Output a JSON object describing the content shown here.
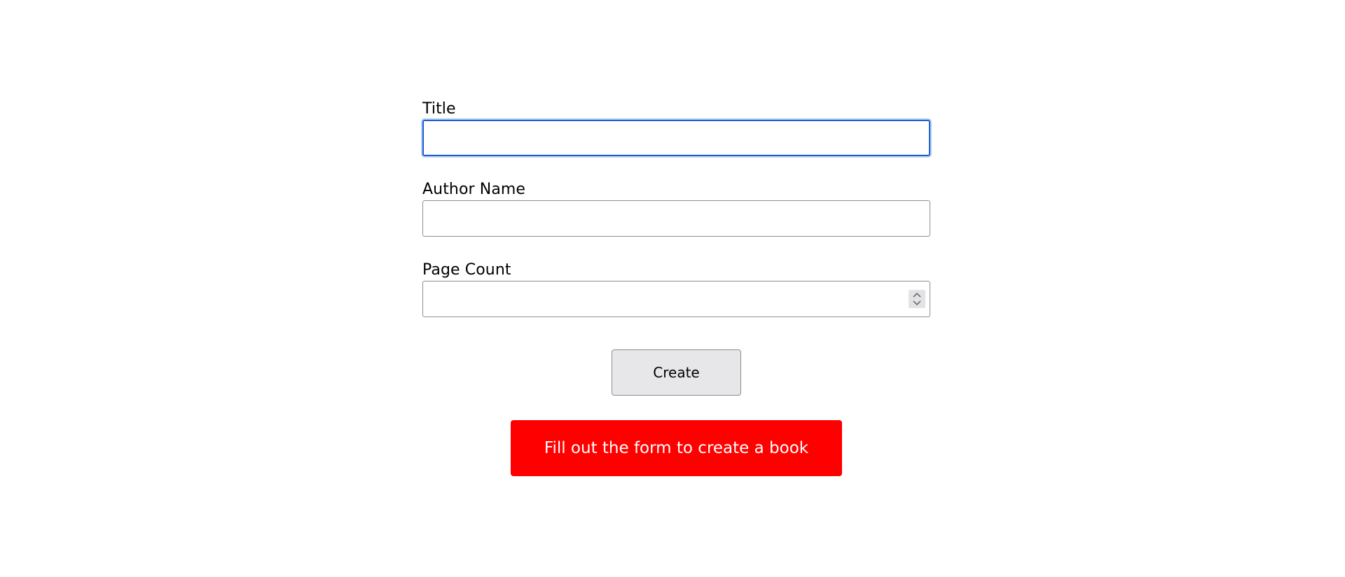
{
  "form": {
    "title_label": "Title",
    "title_value": "",
    "author_label": "Author Name",
    "author_value": "",
    "page_count_label": "Page Count",
    "page_count_value": ""
  },
  "actions": {
    "create_label": "Create"
  },
  "alert": {
    "message": "Fill out the form to create a book",
    "color": "#ff0000"
  },
  "icons": {
    "spinner": "spinner-arrows-icon"
  },
  "colors": {
    "focus_border": "#1a5fd1",
    "button_bg": "#e7e7ea"
  }
}
